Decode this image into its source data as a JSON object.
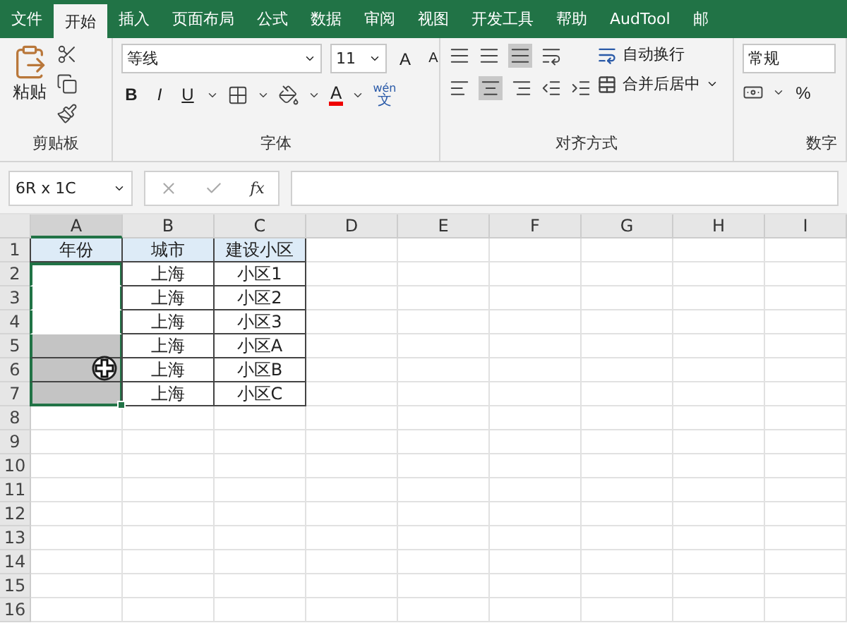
{
  "tabs": [
    {
      "label": "文件",
      "selected": false
    },
    {
      "label": "开始",
      "selected": true
    },
    {
      "label": "插入",
      "selected": false
    },
    {
      "label": "页面布局",
      "selected": false
    },
    {
      "label": "公式",
      "selected": false
    },
    {
      "label": "数据",
      "selected": false
    },
    {
      "label": "审阅",
      "selected": false
    },
    {
      "label": "视图",
      "selected": false
    },
    {
      "label": "开发工具",
      "selected": false
    },
    {
      "label": "帮助",
      "selected": false
    },
    {
      "label": "AudTool",
      "selected": false
    },
    {
      "label": "邮",
      "selected": false
    }
  ],
  "ribbon": {
    "clipboard": {
      "paste": "粘贴",
      "label": "剪贴板"
    },
    "font": {
      "name": "等线",
      "size": "11",
      "grow": "A",
      "shrink": "A",
      "bold": "B",
      "italic": "I",
      "underline": "U",
      "color_letter": "A",
      "phonetic_top": "wén",
      "phonetic": "文",
      "label": "字体"
    },
    "alignment": {
      "wrap": "自动换行",
      "merge": "合并后居中",
      "label": "对齐方式"
    },
    "number": {
      "format": "常规",
      "percent": "%",
      "label": "数字"
    }
  },
  "formula_bar": {
    "name_box": "6R x 1C",
    "fx": "fx"
  },
  "sheet": {
    "columns": [
      {
        "label": "A",
        "selected": true
      },
      {
        "label": "B",
        "selected": false
      },
      {
        "label": "C",
        "selected": false
      },
      {
        "label": "D",
        "selected": false
      },
      {
        "label": "E",
        "selected": false
      },
      {
        "label": "F",
        "selected": false
      },
      {
        "label": "G",
        "selected": false
      },
      {
        "label": "H",
        "selected": false
      },
      {
        "label": "I",
        "selected": false
      }
    ],
    "rows": [
      {
        "label": "1",
        "cells": [
          {
            "text": "年份",
            "kind": "header",
            "selected": false,
            "shaded": false
          },
          {
            "text": "城市",
            "kind": "header",
            "selected": false,
            "shaded": false
          },
          {
            "text": "建设小区",
            "kind": "header",
            "selected": false,
            "shaded": false
          }
        ]
      },
      {
        "label": "2",
        "cells": [
          {
            "kind": "blank",
            "selected": true,
            "shaded": false
          },
          {
            "text": "上海",
            "kind": "data",
            "selected": false,
            "shaded": false
          },
          {
            "text": "小区1",
            "kind": "data",
            "selected": false,
            "shaded": false
          }
        ]
      },
      {
        "label": "3",
        "cells": [
          {
            "kind": "blank",
            "selected": true,
            "shaded": false
          },
          {
            "text": "上海",
            "kind": "data",
            "selected": false,
            "shaded": false
          },
          {
            "text": "小区2",
            "kind": "data",
            "selected": false,
            "shaded": false
          }
        ]
      },
      {
        "label": "4",
        "cells": [
          {
            "kind": "blank",
            "selected": true,
            "shaded": false
          },
          {
            "text": "上海",
            "kind": "data",
            "selected": false,
            "shaded": false
          },
          {
            "text": "小区3",
            "kind": "data",
            "selected": false,
            "shaded": false
          }
        ]
      },
      {
        "label": "5",
        "cells": [
          {
            "kind": "blank",
            "selected": true,
            "shaded": true
          },
          {
            "text": "上海",
            "kind": "data",
            "selected": false,
            "shaded": false
          },
          {
            "text": "小区A",
            "kind": "data",
            "selected": false,
            "shaded": false
          }
        ]
      },
      {
        "label": "6",
        "cells": [
          {
            "kind": "blank",
            "selected": true,
            "shaded": true,
            "cursor": true
          },
          {
            "text": "上海",
            "kind": "data",
            "selected": false,
            "shaded": false
          },
          {
            "text": "小区B",
            "kind": "data",
            "selected": false,
            "shaded": false
          }
        ]
      },
      {
        "label": "7",
        "cells": [
          {
            "kind": "blank",
            "selected": true,
            "shaded": true
          },
          {
            "text": "上海",
            "kind": "data",
            "selected": false,
            "shaded": false
          },
          {
            "text": "小区C",
            "kind": "data",
            "selected": false,
            "shaded": false
          }
        ]
      },
      {
        "label": "8",
        "cells": []
      },
      {
        "label": "9",
        "cells": []
      },
      {
        "label": "10",
        "cells": []
      },
      {
        "label": "11",
        "cells": []
      },
      {
        "label": "12",
        "cells": []
      },
      {
        "label": "13",
        "cells": []
      },
      {
        "label": "14",
        "cells": []
      },
      {
        "label": "15",
        "cells": []
      },
      {
        "label": "16",
        "cells": []
      }
    ]
  }
}
